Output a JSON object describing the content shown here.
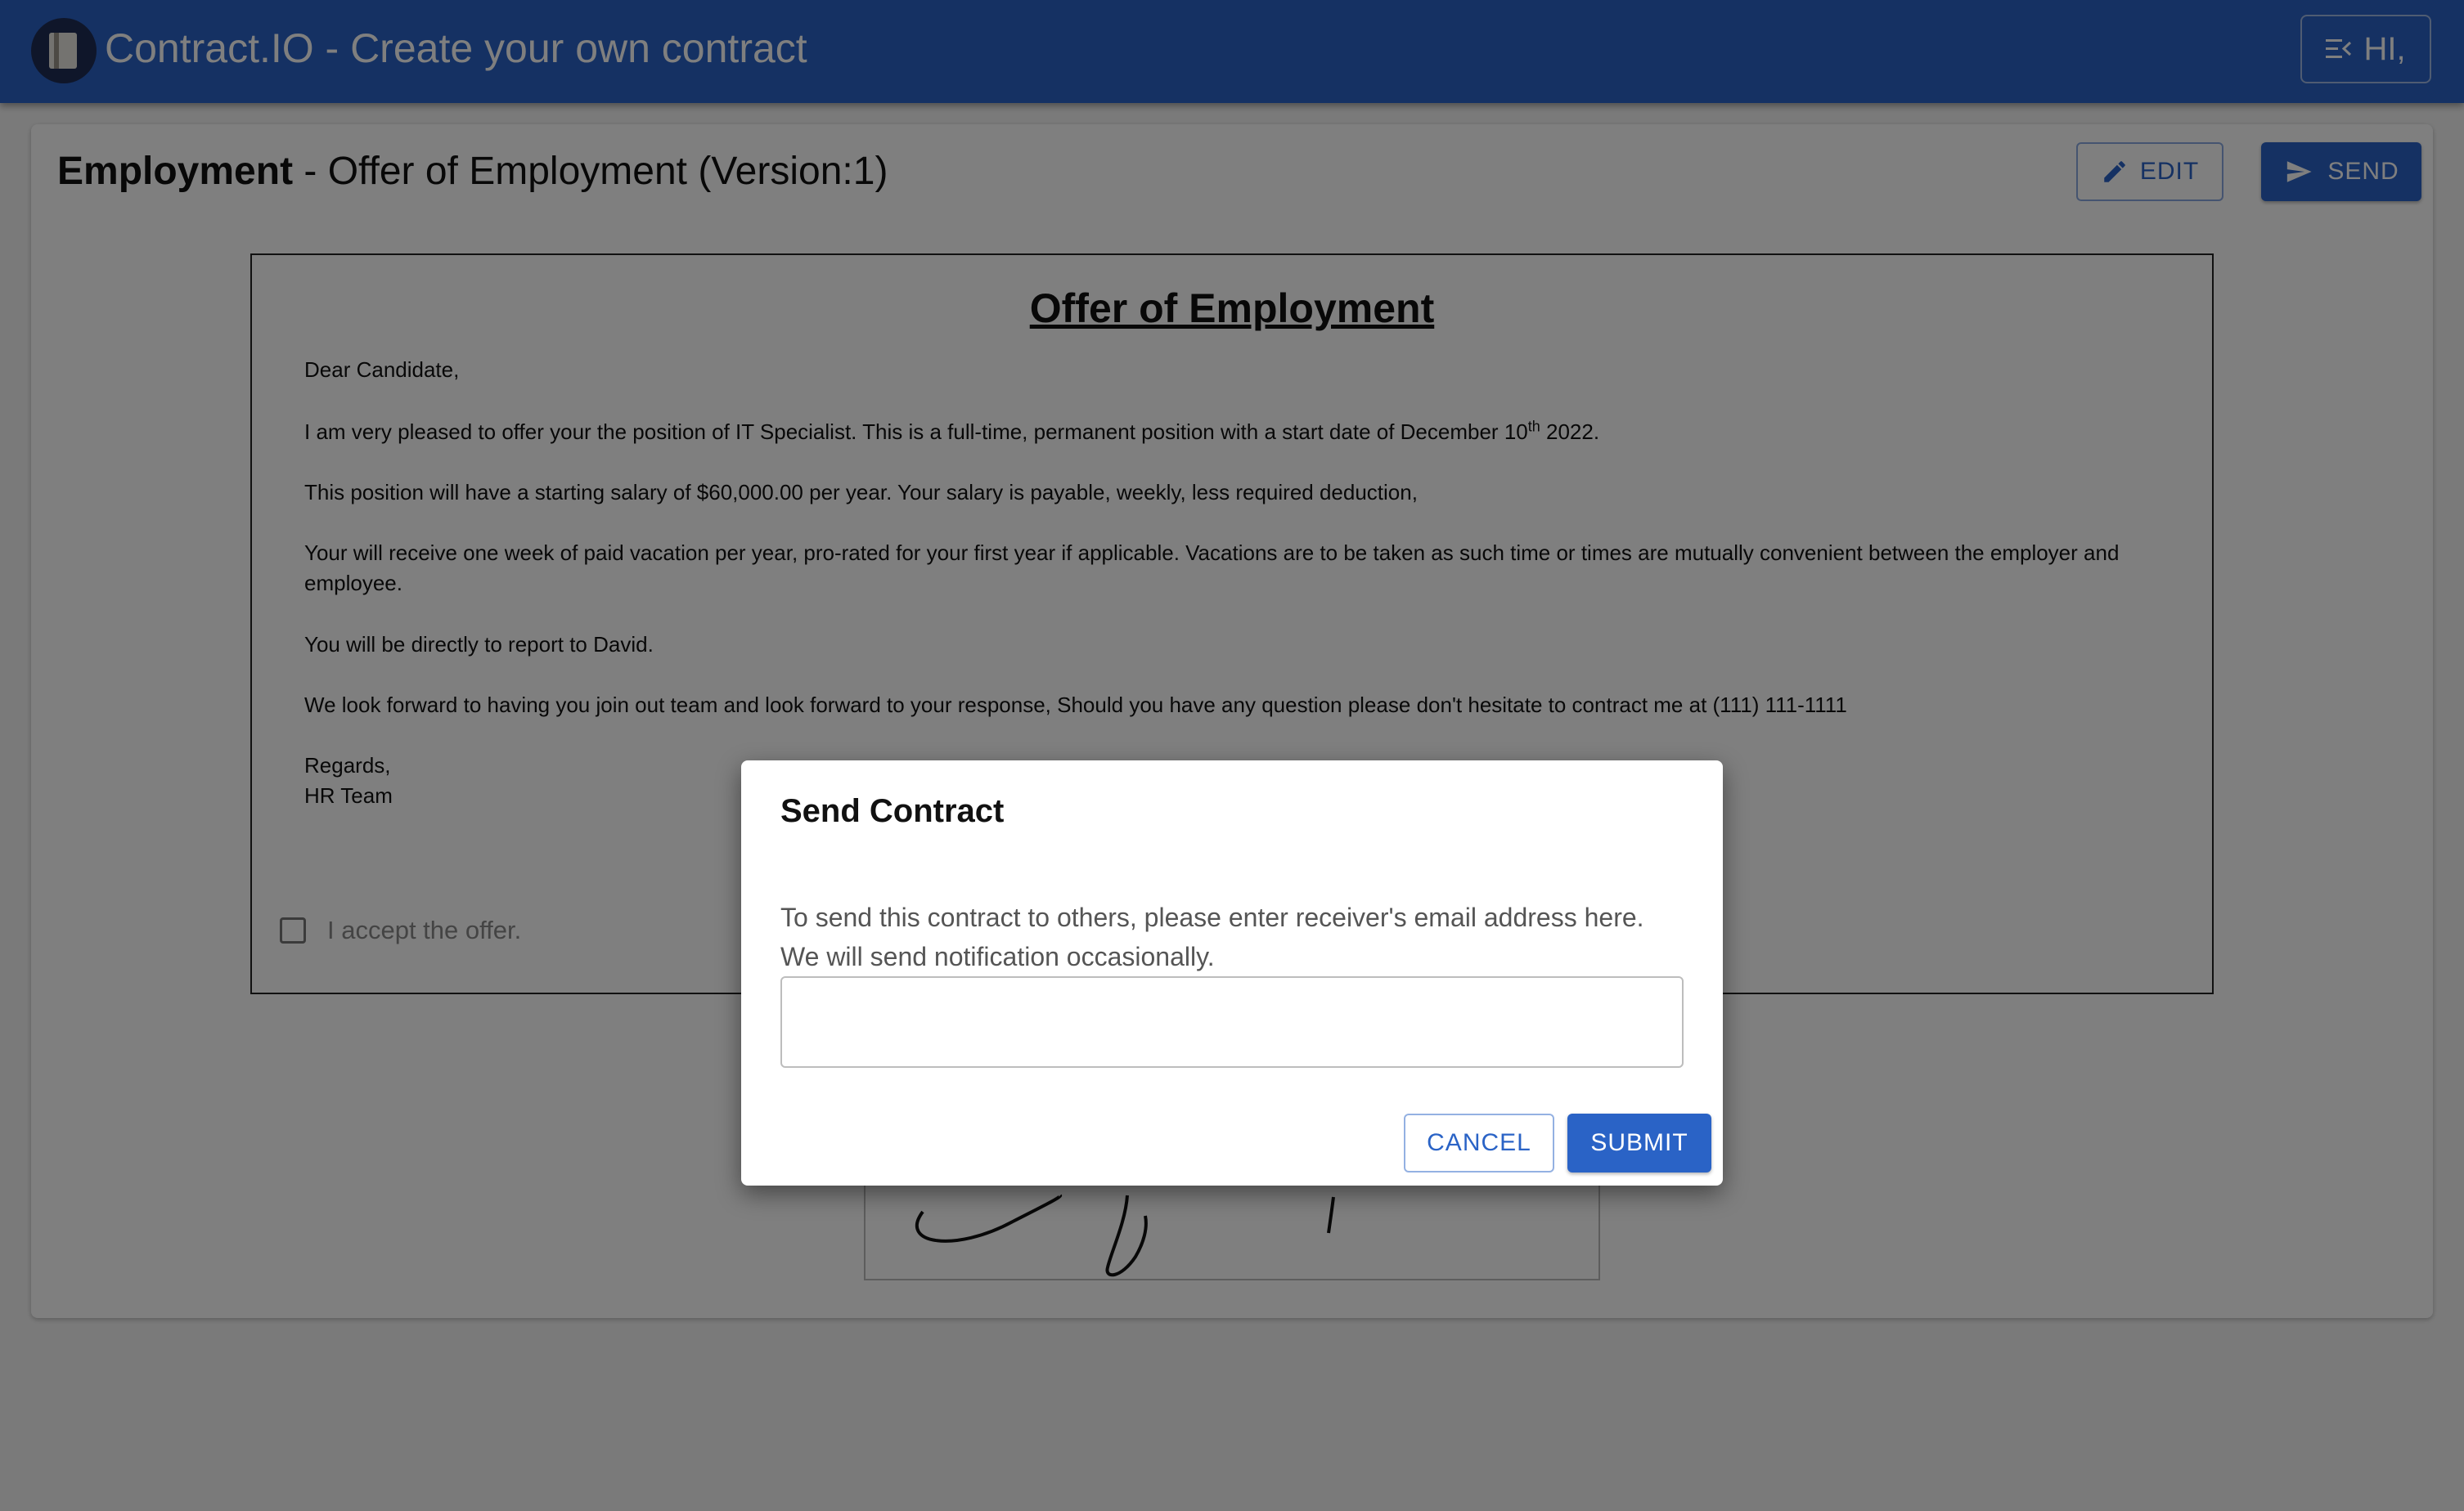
{
  "app": {
    "title": "Contract.IO - Create your own contract",
    "user_greeting": "HI,"
  },
  "page": {
    "category": "Employment",
    "separator": " - ",
    "name": "Offer of Employment (Version:1)",
    "edit_label": "EDIT",
    "send_label": "SEND"
  },
  "contract": {
    "heading": "Offer of Employment",
    "greeting": "Dear Candidate,",
    "p1_before": "I am very pleased to offer your the position of IT Specialist. This is a full-time, permanent position with a start date of December 10",
    "p1_sup": "th",
    "p1_after": " 2022.",
    "p2": "This position will have a starting salary of $60,000.00 per year. Your salary is payable, weekly, less required deduction,",
    "p3": "Your will receive one week of paid vacation per year, pro-rated for your first year if applicable. Vacations are to be taken as such time or times are mutually convenient between the employer and employee.",
    "p4": "You will be directly to report to David.",
    "p5": "We look forward to having you join out team and look forward to your response, Should you have any question please don't hesitate to contract me at (111) 111-1111",
    "closing": "Regards,",
    "signatory": "HR Team",
    "accept_label": "I accept the offer.",
    "accept_checked": false
  },
  "dialog": {
    "title": "Send Contract",
    "line1": "To send this contract to others, please enter receiver's email address here.",
    "line2": "We will send notification occasionally.",
    "email_value": "",
    "cancel_label": "CANCEL",
    "submit_label": "SUBMIT"
  },
  "colors": {
    "primary": "#2a63c6",
    "overlay": "rgba(0,0,0,0.5)"
  },
  "icons": {
    "menu_open": "menu-open-icon",
    "edit": "pencil-icon",
    "send": "send-icon",
    "logo": "document-logo-icon"
  }
}
